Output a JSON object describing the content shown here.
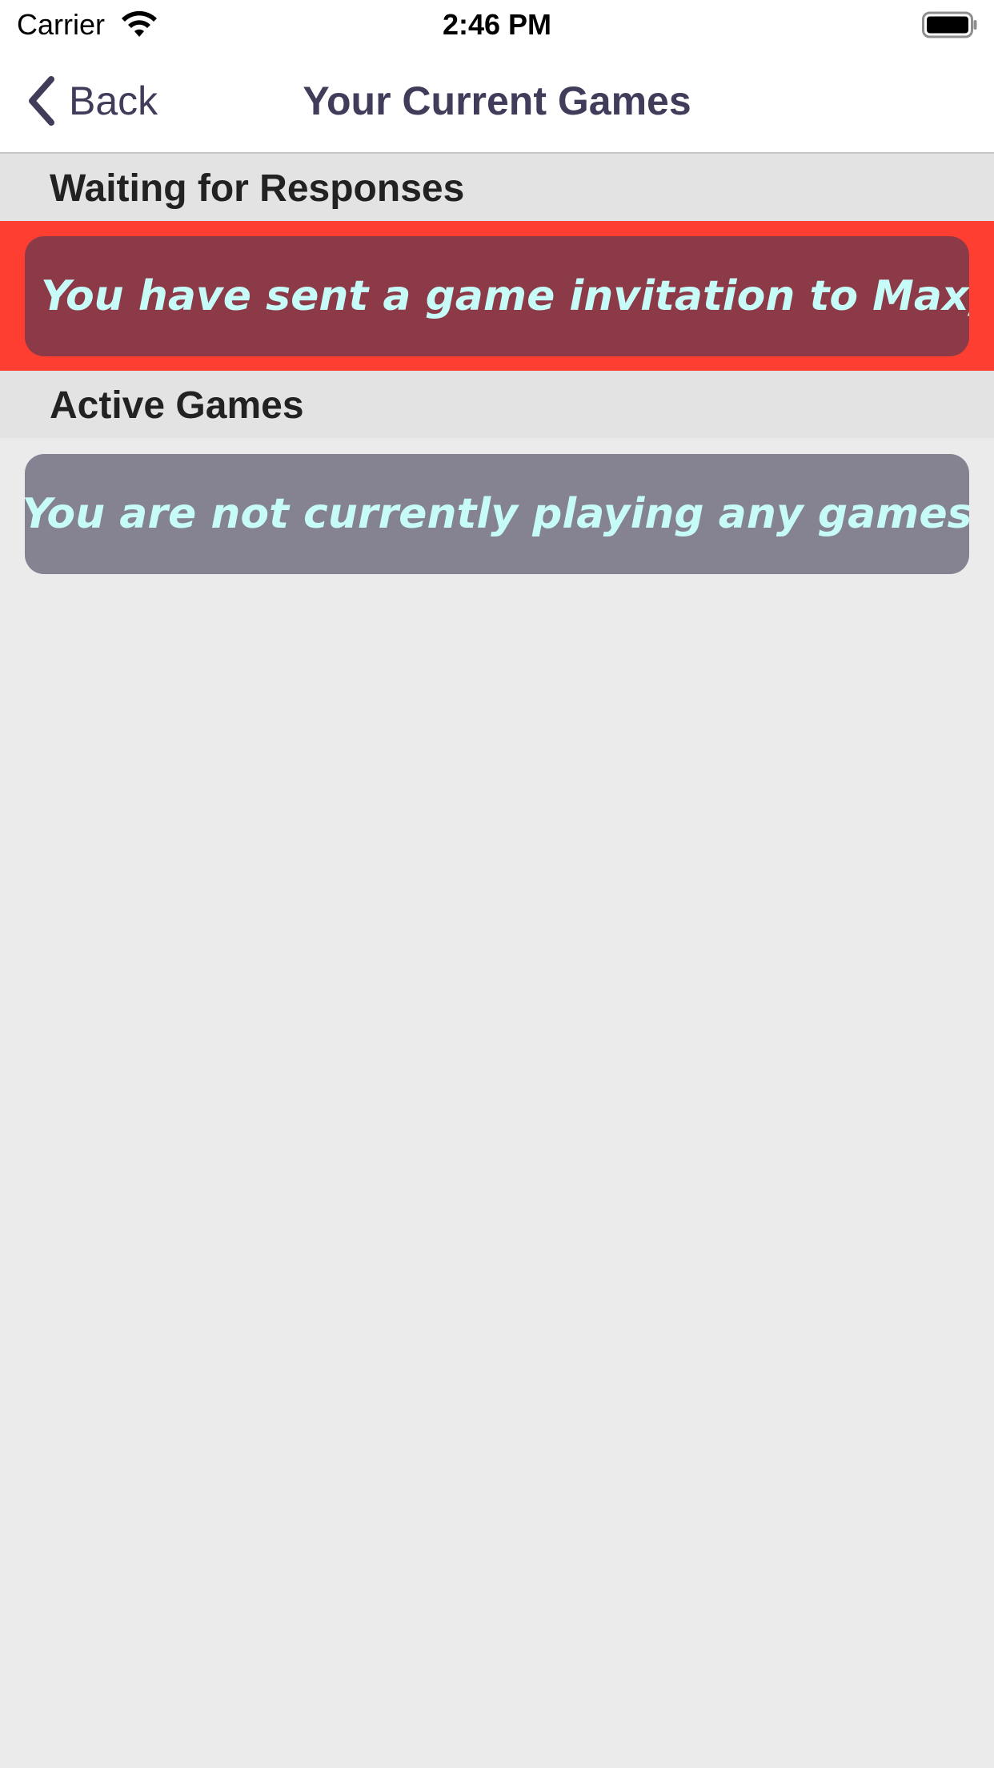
{
  "status_bar": {
    "carrier": "Carrier",
    "time": "2:46 PM",
    "icons": [
      "wifi-icon",
      "battery-icon"
    ]
  },
  "nav": {
    "back_label": "Back",
    "title": "Your Current Games",
    "icons": [
      "chevron-left-icon"
    ]
  },
  "sections": {
    "waiting": {
      "header": "Waiting for Responses",
      "items": [
        {
          "text": "You have sent a game invitation to Max, Tim"
        }
      ]
    },
    "active": {
      "header": "Active Games",
      "items": [
        {
          "text": "You are not currently playing any games"
        }
      ]
    }
  },
  "colors": {
    "accent": "#403c5a",
    "selected_row": "#fe3e31",
    "invite_card": "#8d3a48",
    "empty_card": "#858292",
    "card_text": "#c6fbf7",
    "background": "#ebebeb"
  }
}
